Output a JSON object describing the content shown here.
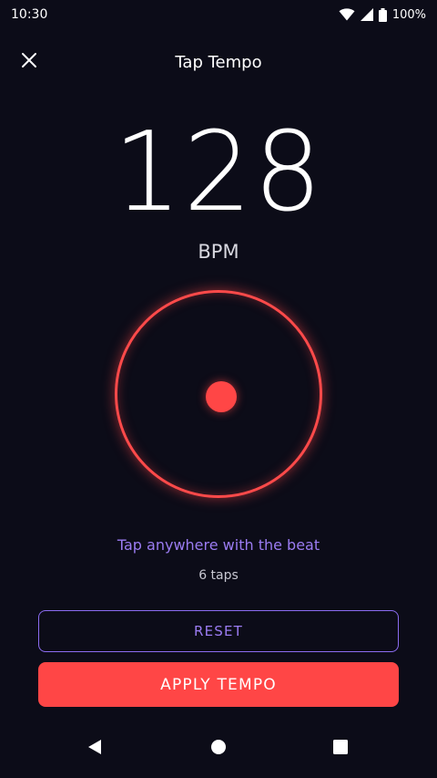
{
  "status_bar": {
    "time": "10:30",
    "battery": "100%",
    "icons": [
      "wifi-icon",
      "signal-icon",
      "battery-icon"
    ]
  },
  "app_bar": {
    "title": "Tap Tempo",
    "close_icon": "close-icon"
  },
  "tempo": {
    "value": "128",
    "unit": "BPM"
  },
  "tap_pad": {
    "ring_color": "#ff4a4a",
    "dot_color": "#ff4646"
  },
  "hint_text": "Tap anywhere with the beat",
  "tap_count": "6 taps",
  "buttons": {
    "reset_label": "RESET",
    "apply_label": "APPLY TEMPO"
  },
  "nav_bar": {
    "icons": [
      "back-icon",
      "home-icon",
      "recents-icon"
    ]
  },
  "colors": {
    "background": "#0c0c18",
    "accent_red": "#ff4646",
    "accent_purple": "#9b7cf2"
  }
}
